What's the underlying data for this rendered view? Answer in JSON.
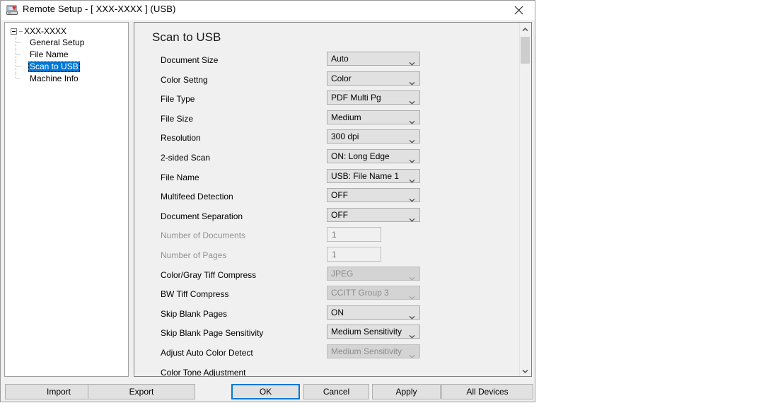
{
  "window": {
    "title": "Remote Setup - [ XXX-XXXX  ] (USB)",
    "app_icon": "scanner-icon",
    "close_icon": "close-icon",
    "accent_color": "#0078d7",
    "selection_color": "#0078d7"
  },
  "tree": {
    "root": {
      "label": "XXX-XXXX",
      "expander_icon": "collapse-box-icon"
    },
    "items": [
      {
        "label": "General Setup",
        "selected": false
      },
      {
        "label": "File Name",
        "selected": false
      },
      {
        "label": "Scan to USB",
        "selected": true
      },
      {
        "label": "Machine Info",
        "selected": false
      }
    ]
  },
  "panel": {
    "title": "Scan to USB",
    "rows": [
      {
        "label": "Document Size",
        "control": "combo",
        "value": "Auto",
        "disabled": false,
        "label_disabled": false
      },
      {
        "label": "Color Settng",
        "control": "combo",
        "value": "Color",
        "disabled": false,
        "label_disabled": false
      },
      {
        "label": "File Type",
        "control": "combo",
        "value": "PDF Multi Pg",
        "disabled": false,
        "label_disabled": false
      },
      {
        "label": "File Size",
        "control": "combo",
        "value": "Medium",
        "disabled": false,
        "label_disabled": false
      },
      {
        "label": "Resolution",
        "control": "combo",
        "value": "300 dpi",
        "disabled": false,
        "label_disabled": false
      },
      {
        "label": "2-sided Scan",
        "control": "combo",
        "value": "ON: Long Edge",
        "disabled": false,
        "label_disabled": false
      },
      {
        "label": "File Name",
        "control": "combo",
        "value": "USB: File Name  1",
        "disabled": false,
        "label_disabled": false
      },
      {
        "label": "Multifeed Detection",
        "control": "combo",
        "value": "OFF",
        "disabled": false,
        "label_disabled": false
      },
      {
        "label": "Document Separation",
        "control": "combo",
        "value": "OFF",
        "disabled": false,
        "label_disabled": false
      },
      {
        "label": "Number of Documents",
        "control": "textbox",
        "value": "1",
        "disabled": true,
        "label_disabled": true
      },
      {
        "label": "Number of Pages",
        "control": "textbox",
        "value": "1",
        "disabled": true,
        "label_disabled": true
      },
      {
        "label": "Color/Gray Tiff Compress",
        "control": "combo",
        "value": "JPEG",
        "disabled": true,
        "label_disabled": false
      },
      {
        "label": "BW Tiff Compress",
        "control": "combo",
        "value": "CCITT Group 3",
        "disabled": true,
        "label_disabled": false
      },
      {
        "label": "Skip Blank Pages",
        "control": "combo",
        "value": "ON",
        "disabled": false,
        "label_disabled": false
      },
      {
        "label": "Skip Blank Page Sensitivity",
        "control": "combo",
        "value": "Medium Sensitivity",
        "disabled": false,
        "label_disabled": false
      },
      {
        "label": "Adjust Auto Color Detect",
        "control": "combo",
        "value": "Medium Sensitivity",
        "disabled": true,
        "label_disabled": false
      },
      {
        "label": "Color Tone Adjustment",
        "control": "none",
        "value": "",
        "disabled": false,
        "label_disabled": false
      }
    ]
  },
  "scrollbar": {
    "up_icon": "chevron-up-icon",
    "down_icon": "chevron-down-icon",
    "thumb": "scroll-thumb"
  },
  "footer": {
    "buttons": [
      {
        "label": "Import",
        "default": false
      },
      {
        "label": "Export",
        "default": false
      },
      {
        "label": "OK",
        "default": true
      },
      {
        "label": "Cancel",
        "default": false
      },
      {
        "label": "Apply",
        "default": false
      },
      {
        "label": "All Devices",
        "default": false
      }
    ]
  }
}
